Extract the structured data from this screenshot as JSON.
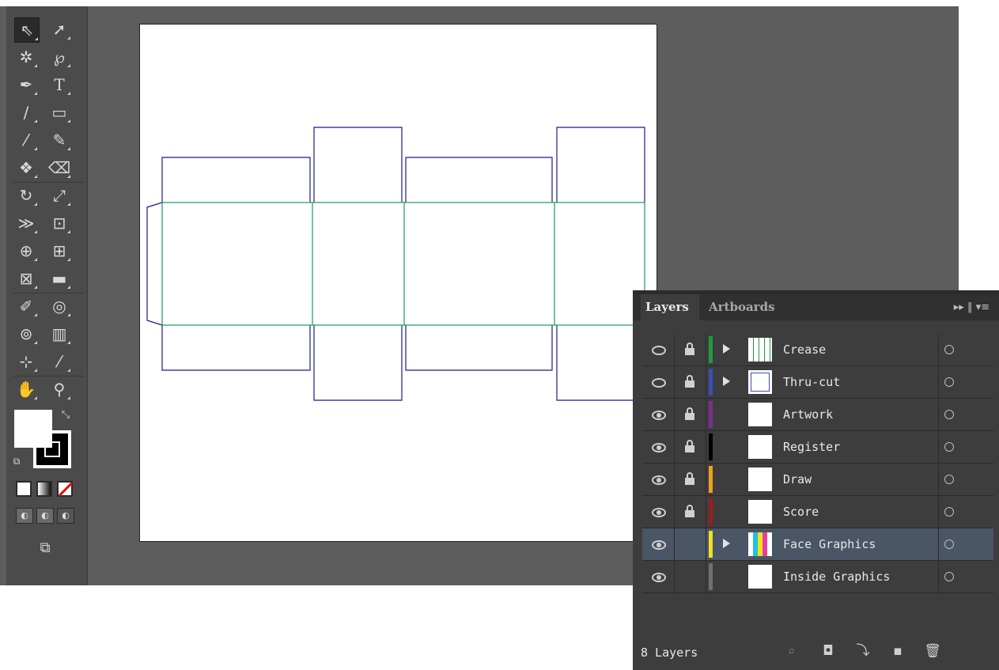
{
  "toolbar": {
    "tools": [
      [
        "selection-tool",
        "direct-selection-tool"
      ],
      [
        "magic-wand-tool",
        "lasso-tool"
      ],
      [
        "pen-tool",
        "type-tool"
      ],
      [
        "line-segment-tool",
        "rectangle-tool"
      ],
      [
        "paintbrush-tool",
        "pencil-tool"
      ],
      [
        "blob-brush-tool",
        "eraser-tool"
      ],
      [
        "rotate-tool",
        "scale-tool"
      ],
      [
        "width-tool",
        "free-transform-tool"
      ],
      [
        "shape-builder-tool",
        "perspective-grid-tool"
      ],
      [
        "mesh-tool",
        "gradient-tool"
      ],
      [
        "eyedropper-tool",
        "blend-tool"
      ],
      [
        "symbol-sprayer-tool",
        "column-graph-tool"
      ],
      [
        "artboard-tool",
        "slice-tool"
      ],
      [
        "hand-tool",
        "zoom-tool"
      ]
    ],
    "type_tool_glyph": "T"
  },
  "layers_panel": {
    "tabs": [
      "Layers",
      "Artboards"
    ],
    "active_tab": "Layers",
    "layer_count": "8 Layers",
    "layers": [
      {
        "name": "Crease",
        "color": "#1f9a3c",
        "visible": "outline",
        "locked": true,
        "expandable": true,
        "selected": false
      },
      {
        "name": "Thru-cut",
        "color": "#3a4fb5",
        "visible": "outline",
        "locked": true,
        "expandable": true,
        "selected": false
      },
      {
        "name": "Artwork",
        "color": "#7a2f8f",
        "visible": "preview",
        "locked": true,
        "expandable": false,
        "selected": false
      },
      {
        "name": "Register",
        "color": "#000000",
        "visible": "preview",
        "locked": true,
        "expandable": false,
        "selected": false
      },
      {
        "name": "Draw",
        "color": "#f0a020",
        "visible": "preview",
        "locked": true,
        "expandable": false,
        "selected": false
      },
      {
        "name": "Score",
        "color": "#9a1e1e",
        "visible": "preview",
        "locked": true,
        "expandable": false,
        "selected": false
      },
      {
        "name": "Face Graphics",
        "color": "#f0e020",
        "visible": "preview",
        "locked": false,
        "expandable": true,
        "selected": true
      },
      {
        "name": "Inside Graphics",
        "color": "#6f6f6f",
        "visible": "preview",
        "locked": false,
        "expandable": false,
        "selected": false
      }
    ]
  },
  "colors": {
    "workspace": "#5c5d5c",
    "dieline_cut": "#1a1a8c",
    "dieline_crease": "#1a9a5a"
  }
}
